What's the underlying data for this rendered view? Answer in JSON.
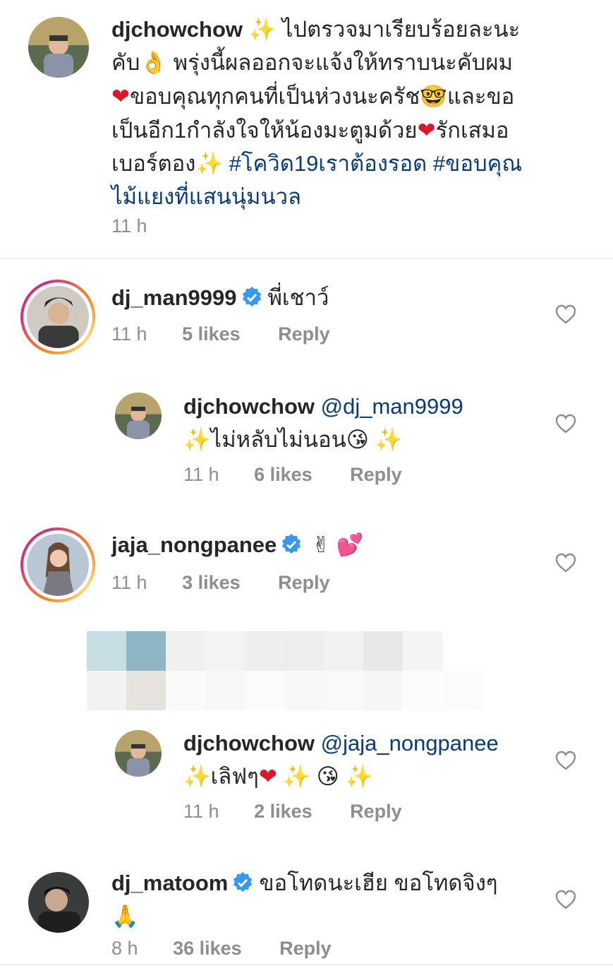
{
  "caption": {
    "username": "djchowchow",
    "line1": "ไปตรวจมาเรียบร้อยละนะ",
    "line2_a": "คับ",
    "line2_b": "พรุ่งนี้ผลออกจะแจ้งให้ทราบนะคับผม",
    "line3": "ขอบคุณทุกคนที่เป็นห่วงนะครัช",
    "line3_b": "และขอ",
    "line4": "เป็นอีก1กำลังใจให้น้องมะตูมด้วย",
    "line4_b": "รักเสมอ",
    "line5": "เบอร์ตอง",
    "hashtag1": "#โควิด19เราต้องรอด",
    "hashtag2": "#ขอบคุณ",
    "line6": "ไม้แยงที่แสนนุ่มนวล",
    "time": "11 h"
  },
  "comments": [
    {
      "username": "dj_man9999",
      "text": "พี่เชาว์",
      "time": "11 h",
      "likes": "5 likes",
      "reply": "Reply"
    },
    {
      "username": "djchowchow",
      "mention": "@dj_man9999",
      "text": "ไม่หลับไม่นอน",
      "time": "11 h",
      "likes": "6 likes",
      "reply": "Reply"
    },
    {
      "username": "jaja_nongpanee",
      "time": "11 h",
      "likes": "3 likes",
      "reply": "Reply"
    },
    {
      "username": "djchowchow",
      "mention": "@jaja_nongpanee",
      "text": "เลิฟๆ",
      "time": "11 h",
      "likes": "2 likes",
      "reply": "Reply"
    },
    {
      "username": "dj_matoom",
      "text": "ขอโทดนะเฮีย ขอโทดจิงๆ",
      "time": "8 h",
      "likes": "36 likes",
      "reply": "Reply"
    }
  ],
  "icons": {
    "verified": "verified-badge-icon",
    "like": "heart-outline-icon"
  },
  "colors": {
    "mention": "#0b3a78",
    "meta": "#8e8e8e",
    "verified": "#3897f0"
  }
}
